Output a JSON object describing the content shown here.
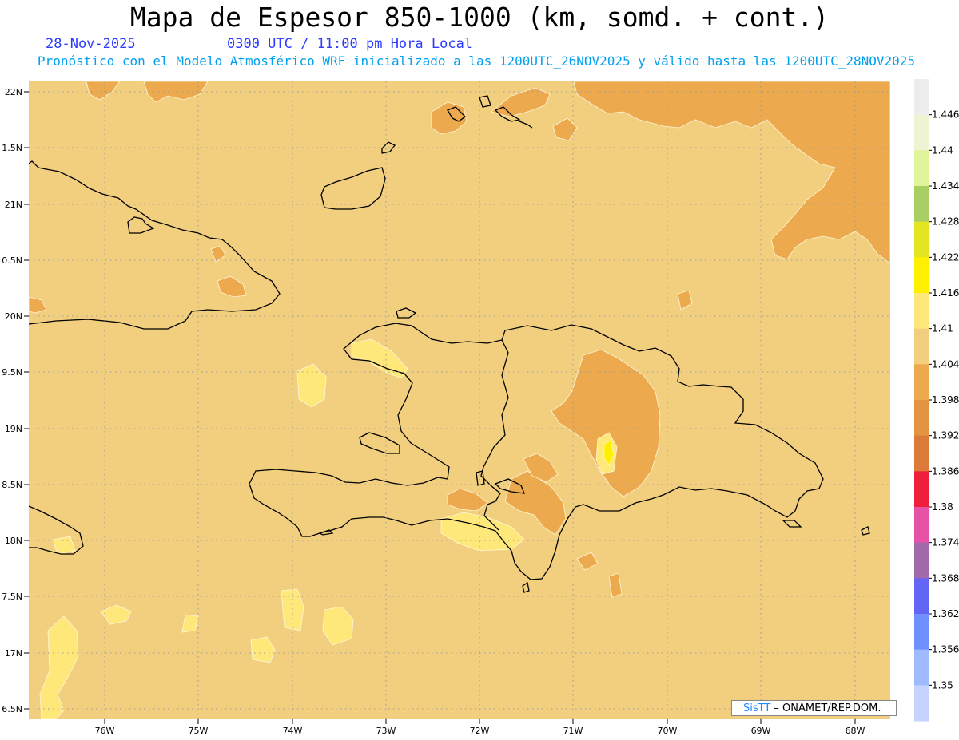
{
  "header": {
    "title": "Mapa de Espesor 850-1000 (km, somd. + cont.)",
    "date": "28-Nov-2025",
    "time": "0300 UTC / 11:00 pm Hora Local",
    "subtitle": "Pronóstico con el Modelo Atmosférico WRF inicializado a las 1200UTC_26NOV2025 y válido hasta las  1200UTC_28NOV2025"
  },
  "axes": {
    "lat_labels": [
      "22N",
      "1.5N",
      "21N",
      "0.5N",
      "20N",
      "9.5N",
      "19N",
      "8.5N",
      "18N",
      "7.5N",
      "17N",
      "6.5N"
    ],
    "lon_labels": [
      "76W",
      "75W",
      "74W",
      "73W",
      "72W",
      "71W",
      "70W",
      "69W",
      "68W"
    ]
  },
  "colorbar": {
    "levels": [
      "1.446",
      "1.44",
      "1.434",
      "1.428",
      "1.422",
      "1.416",
      "1.41",
      "1.404",
      "1.398",
      "1.392",
      "1.386",
      "1.38",
      "1.374",
      "1.368",
      "1.362",
      "1.356",
      "1.35"
    ],
    "colors": [
      "#ededed",
      "#eef3d2",
      "#e0f49a",
      "#a8cf64",
      "#e4e622",
      "#fff000",
      "#ffe87a",
      "#f2cf7e",
      "#eca94d",
      "#e39440",
      "#dc7b39",
      "#ef1e3c",
      "#e652a8",
      "#a36aab",
      "#6366f5",
      "#6f90ff",
      "#a0baff",
      "#c4d4ff"
    ]
  },
  "credit": {
    "brand": "SisTT",
    "rest": " – ONAMET/REP.DOM."
  }
}
